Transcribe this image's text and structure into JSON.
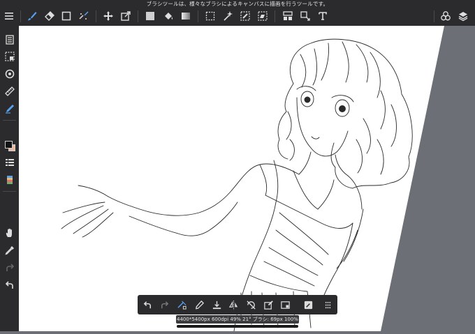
{
  "hint_text": "ブラシツールは、様々なブラシによるキャンバスに描画を行うツールです。",
  "status_text": "4400*5400px 600dpi 49% 21° ブラシ: 69px 100%",
  "colors": {
    "toolbar_bg": "#2b2b2d",
    "canvas_paper": "#ffffff",
    "canvas_outside": "#6c6f75",
    "active_tool": "#5aa0f0",
    "secondary_color": "#e9b9a0"
  },
  "top_toolbar_icons": [
    "menu-icon",
    "brush-tool-icon",
    "eraser-tool-icon",
    "shape-tool-icon",
    "correction-tool-icon",
    "move-tool-icon",
    "transform-tool-icon",
    "fill-color-icon",
    "bucket-tool-icon",
    "gradient-tool-icon",
    "lasso-select-icon",
    "magic-wand-icon",
    "select-pen-icon",
    "select-eraser-icon",
    "select-layer-icon",
    "text-frame-icon",
    "text-tool-icon",
    "materials-icon",
    "layers-icon"
  ],
  "sidebar_icons": [
    "brush-list-icon",
    "selection-icon",
    "rotate-icon",
    "ruler-icon",
    "snap-pen-icon",
    "color-swatch-icon",
    "brush-settings-icon",
    "color-palette-icon",
    "hand-tool-icon",
    "eyedropper-icon",
    "redo-icon",
    "undo-icon"
  ],
  "bottom_toolbar_icons": [
    "undo-icon",
    "redo-icon",
    "transform-select-icon",
    "pen-icon",
    "import-icon",
    "flip-icon",
    "rotate-reset-icon",
    "edit-selection-icon",
    "fit-view-icon",
    "fullscreen-icon",
    "more-icon"
  ]
}
